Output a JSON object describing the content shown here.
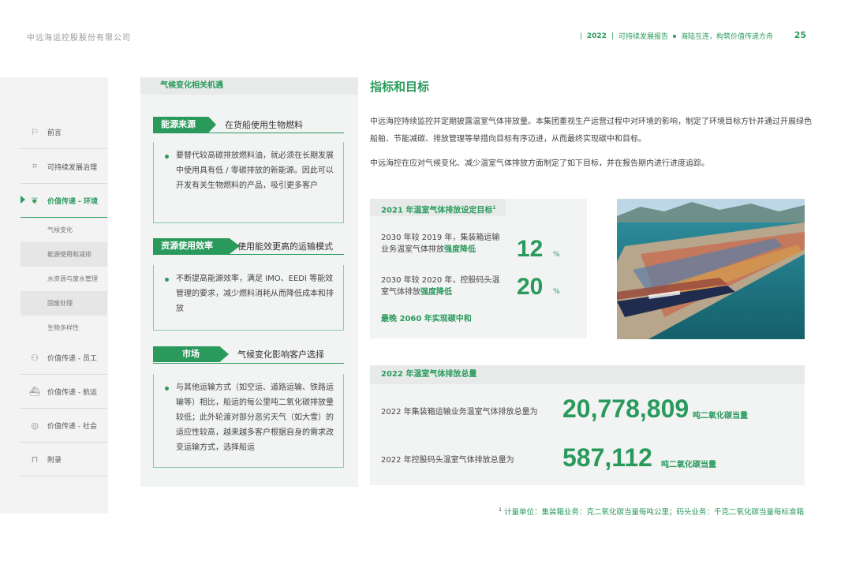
{
  "header": {
    "company": "中远海运控股股份有限公司",
    "year": "2022",
    "report": "可持续发展报告",
    "slogan": "海陆互连，构筑价值传递方舟",
    "page": "25"
  },
  "sidebar": {
    "items": [
      {
        "label": "前言",
        "icon": "flag-icon"
      },
      {
        "label": "可持续发展治理",
        "icon": "governance-icon"
      },
      {
        "label": "价值传递 - 环境",
        "icon": "leaf-icon",
        "active": true
      },
      {
        "label": "价值传递 - 员工",
        "icon": "people-icon"
      },
      {
        "label": "价值传递 - 航运",
        "icon": "ship-icon"
      },
      {
        "label": "价值传递 - 社会",
        "icon": "globe-icon"
      },
      {
        "label": "附录",
        "icon": "appendix-icon"
      }
    ],
    "subitems": [
      "气候变化",
      "能源使用和减排",
      "水资源与废水管理",
      "固废处理",
      "生物多样性"
    ]
  },
  "opportunities": {
    "title": "气候变化相关机遇",
    "categories": [
      {
        "tag": "能源来源",
        "subtitle": "在货船使用生物燃料",
        "text": "要替代较高碳排放燃料油，就必须在长期发展中使用具有低 / 零碳排放的新能源。因此可以开发有关生物燃料的产品，吸引更多客户"
      },
      {
        "tag": "资源使用效率",
        "subtitle": "使用能效更高的运输模式",
        "text": "不断提高能源效率，满足 IMO、EEDI 等能效管理的要求，减少燃料消耗从而降低成本和排放"
      },
      {
        "tag": "市场",
        "subtitle": "气候变化影响客户选择",
        "text": "与其他运输方式（如空运、道路运输、铁路运输等）相比，船运的每公里吨二氧化碳排放量较低；此外轮渡对部分恶劣天气（如大雪）的适应性较高，越来越多客户根据自身的需求改变运输方式，选择船运"
      }
    ]
  },
  "main": {
    "title": "指标和目标",
    "intro1": "中远海控持续监控并定期披露温室气体排放量。本集团重视生产运营过程中对环境的影响，制定了环境目标方针并通过开展绿色船舶、节能减碳、排放管理等举措向目标有序迈进，从而最终实现碳中和目标。",
    "intro2": "中远海控在应对气候变化、减少温室气体排放方面制定了如下目标，并在报告期内进行进度追踪。"
  },
  "targets": {
    "title": "2021 年温室气体排放设定目标",
    "footnote_mark": "1",
    "rows": [
      {
        "label_plain": "2030 年较 2019 年，集装箱运输业务温室气体排放",
        "label_bold": "强度降低",
        "value": "12",
        "unit": "%"
      },
      {
        "label_plain": "2030 年较 2020 年，控股码头温室气体排放",
        "label_bold": "强度降低",
        "value": "20",
        "unit": "%"
      }
    ],
    "final": "最晚 2060 年实现碳中和"
  },
  "emissions": {
    "title": "2022 年温室气体排放总量",
    "rows": [
      {
        "label": "2022 年集装箱运输业务温室气体排放总量为",
        "value": "20,778,809",
        "unit": "吨二氧化碳当量"
      },
      {
        "label": "2022 年控股码头温室气体排放总量为",
        "value": "587,112",
        "unit": "吨二氧化碳当量"
      }
    ]
  },
  "footnote": {
    "mark": "1",
    "text": "计量单位：集装箱业务：克二氧化碳当量每吨公里；码头业务：千克二氧化碳当量每标准箱"
  },
  "colors": {
    "accent": "#2a9a5c",
    "panel": "#f2f3f3"
  }
}
